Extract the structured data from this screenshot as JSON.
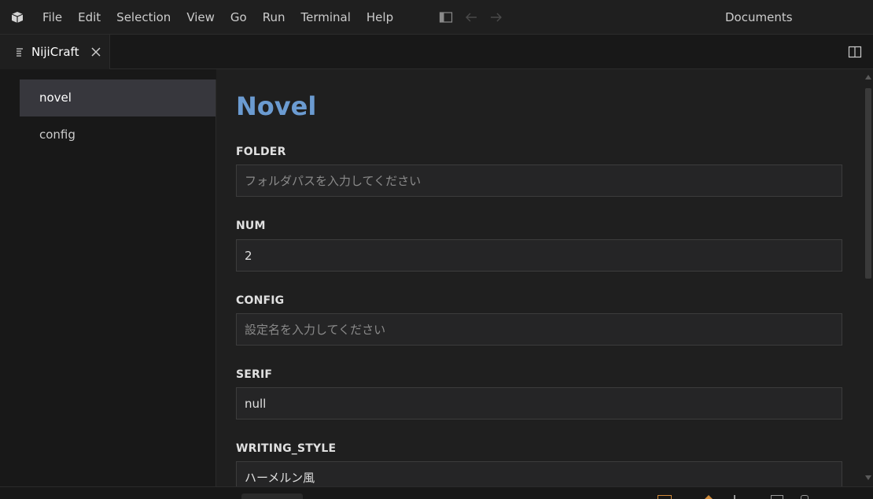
{
  "menubar": {
    "items": [
      "File",
      "Edit",
      "Selection",
      "View",
      "Go",
      "Run",
      "Terminal",
      "Help"
    ]
  },
  "window": {
    "title": "Documents"
  },
  "tab": {
    "label": "NijiCraft",
    "close": "×"
  },
  "sidebar": {
    "items": [
      {
        "label": "novel",
        "active": true
      },
      {
        "label": "config",
        "active": false
      }
    ]
  },
  "form": {
    "title": "Novel",
    "fields": [
      {
        "label": "FOLDER",
        "value": "",
        "placeholder": "フォルダパスを入力してください"
      },
      {
        "label": "NUM",
        "value": "2",
        "placeholder": ""
      },
      {
        "label": "CONFIG",
        "value": "",
        "placeholder": "設定名を入力してください"
      },
      {
        "label": "SERIF",
        "value": "null",
        "placeholder": ""
      },
      {
        "label": "WRITING_STYLE",
        "value": "ハーメルン風",
        "placeholder": ""
      }
    ]
  },
  "colors": {
    "accent_title": "#6b9bd1",
    "background": "#1f1f1f",
    "active_item": "#37373d"
  },
  "icons": {
    "app": "vscode-logo-icon",
    "toggle_sidebar": "toggle-sidebar-icon",
    "back": "arrow-left-icon",
    "forward": "arrow-right-icon",
    "tab": "preview-icon",
    "close": "close-icon",
    "split": "split-editor-icon"
  }
}
